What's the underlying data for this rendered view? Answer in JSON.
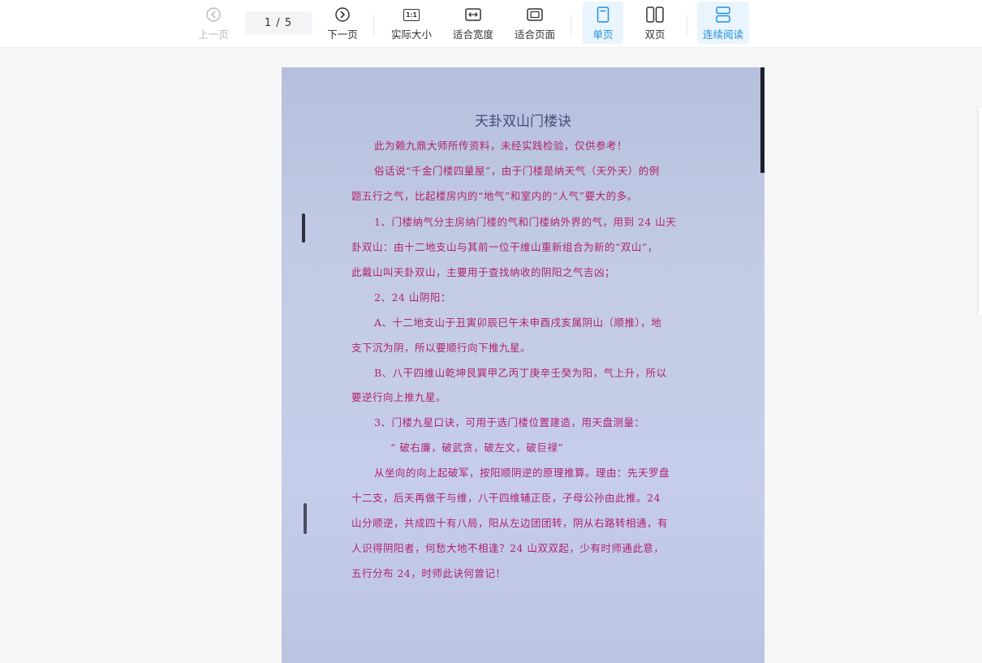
{
  "toolbar": {
    "prev_label": "上一页",
    "page_indicator": "1 / 5",
    "next_label": "下一页",
    "actual_size_label": "实际大小",
    "actual_size_icon_text": "1:1",
    "fit_width_label": "适合宽度",
    "fit_page_label": "适合页面",
    "single_page_label": "单页",
    "double_page_label": "双页",
    "continuous_label": "连续阅读",
    "icons": {
      "prev": "chevron-left-circle-icon",
      "next": "chevron-right-circle-icon",
      "actual_size": "actual-size-icon",
      "fit_width": "fit-width-icon",
      "fit_page": "fit-page-icon",
      "single_page": "single-page-icon",
      "double_page": "double-page-icon",
      "continuous": "continuous-read-icon"
    },
    "accent_color": "#1e90e0"
  },
  "document": {
    "title": "天卦双山门楼诀",
    "lines": [
      "此为赖九鼎大师所传资料，未经实践检验，仅供参考！",
      "俗话说“千金门楼四量屋”，由于门楼是纳天气（天外天）的例",
      "题五行之气，比起楼房内的“地气”和室内的“人气”要大的多。",
      "1、门楼纳气分主房纳门楼的气和门楼纳外界的气，用到 24 山天",
      "卦双山：由十二地支山与其前一位干维山重新组合为新的“双山”，",
      "此戴山叫天卦双山，主要用于查找纳收的阴阳之气吉凶；",
      "2、24 山阴阳：",
      "A、十二地支山于丑寅卯辰巳午未申酉戌亥属阴山（顺推），地",
      "支下沉为阴，所以要顺行向下推九星。",
      "B、八干四维山乾坤艮巽甲乙丙丁庚辛壬癸为阳，气上升，所以",
      "要逆行向上推九星。",
      "3、门楼九星口诀，可用于选门楼位置建造，用天盘测量：",
      "“ 破右廉，破武贪，破左文，破巨禄”",
      "从坐向的向上起破军，按阳顺阴逆的原理推算。理由：先天罗盘",
      "十二支，后天再做干与维，八干四维辅正臣，子母公孙由此推。24",
      "山分顺逆，共成四十有八局，阳从左边团团转，阴从右路转相通，有",
      "人识得阴阳者，何愁大地不相逢？24 山双双起，少有时师通此意，",
      "五行分布 24，时师此诀何曾记！"
    ],
    "text_color": "#b0236e",
    "paper_color": "#c3cbe6"
  }
}
